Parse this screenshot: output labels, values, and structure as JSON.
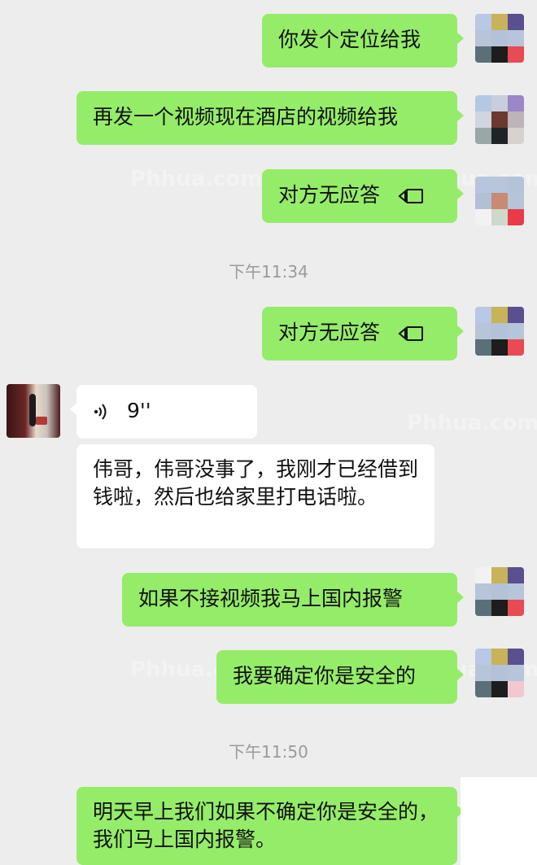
{
  "messages": {
    "m1": "你发个定位给我",
    "m2": "再发一个视频现在酒店的视频给我",
    "m3": "对方无应答",
    "m4": "对方无应答",
    "m5_duration": "9''",
    "m6": "伟哥，伟哥没事了，我刚才已经借到钱啦，然后也给家里打电话啦。",
    "m7": "如果不接视频我马上国内报警",
    "m8": "我要确定你是安全的",
    "m9": "明天早上我们如果不确定你是安全的，我们马上国内报警。"
  },
  "timestamps": {
    "t1": "下午11:34",
    "t2": "下午11:50"
  },
  "watermark": "Phhua.com",
  "colors": {
    "background": "#ededed",
    "outgoing_bubble": "#95ec69",
    "incoming_bubble": "#ffffff",
    "timestamp": "#9a9a9a"
  }
}
